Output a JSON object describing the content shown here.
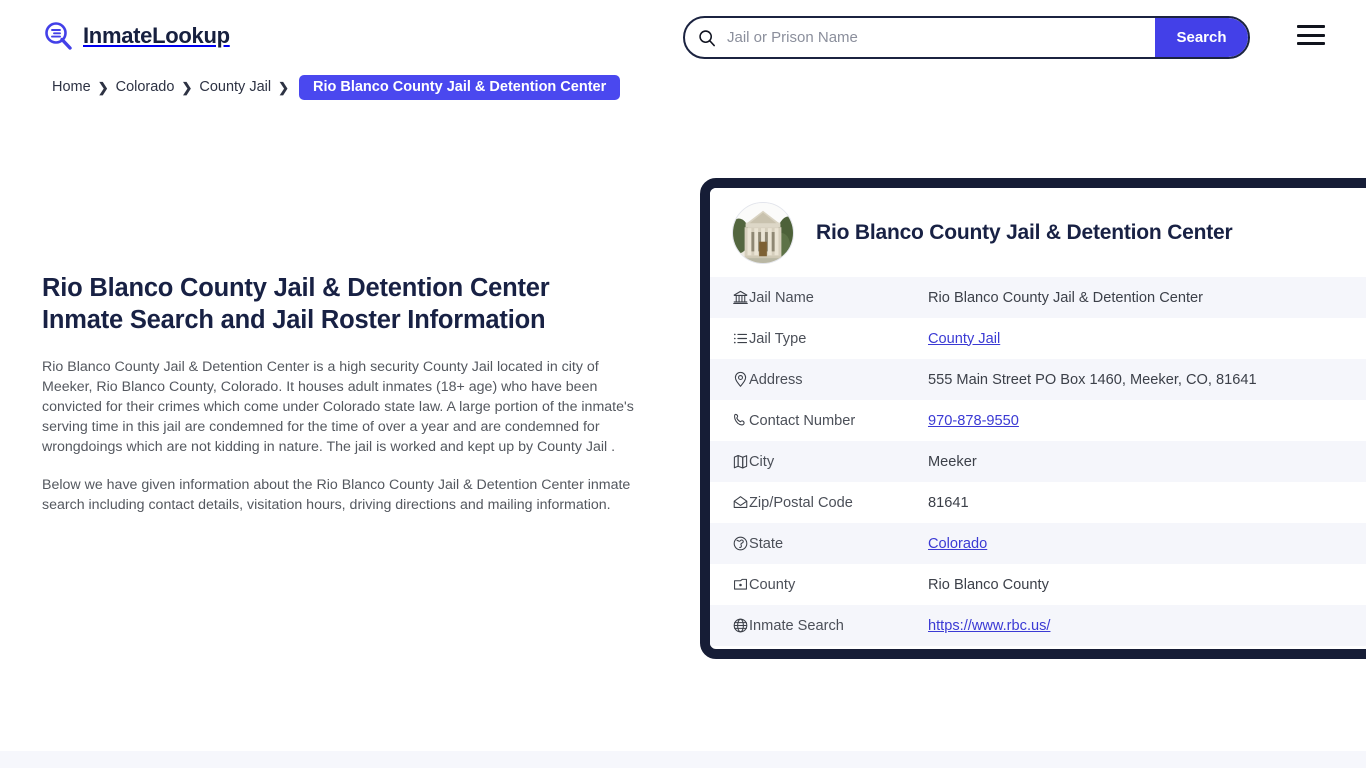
{
  "brand": {
    "name": "InmateLookup",
    "logo_icon": "search-list-icon",
    "accent_color": "#4340e8",
    "dark_color": "#161d36"
  },
  "search": {
    "placeholder": "Jail or Prison Name",
    "value": "",
    "button_label": "Search",
    "icon": "search-icon"
  },
  "menu": {
    "icon": "hamburger-menu-icon"
  },
  "breadcrumb": {
    "items": [
      {
        "label": "Home",
        "current": false
      },
      {
        "label": "Colorado",
        "current": false
      },
      {
        "label": "County Jail",
        "current": false
      },
      {
        "label": "Rio Blanco County Jail & Detention Center",
        "current": true
      }
    ],
    "separator": "❯"
  },
  "main": {
    "title": "Rio Blanco County Jail & Detention Center Inmate Search and Jail Roster Information",
    "paragraph_1": "Rio Blanco County Jail & Detention Center is a high security County Jail located in city of Meeker, Rio Blanco County, Colorado. It houses adult inmates (18+ age) who have been convicted for their crimes which come under Colorado state law. A large portion of the inmate's serving time in this jail are condemned for the time of over a year and are condemned for wrongdoings which are not kidding in nature. The jail is worked and kept up by County Jail .",
    "paragraph_2": "Below we have given information about the Rio Blanco County Jail & Detention Center inmate search including contact details, visitation hours, driving directions and mailing information."
  },
  "card": {
    "avatar_icon": "courthouse-building-photo",
    "title": "Rio Blanco County Jail & Detention Center",
    "rows": [
      {
        "icon": "bank-icon",
        "label": "Jail Name",
        "value": "Rio Blanco County Jail & Detention Center",
        "link": false
      },
      {
        "icon": "list-icon",
        "label": "Jail Type",
        "value": "County Jail",
        "link": true
      },
      {
        "icon": "map-pin-icon",
        "label": "Address",
        "value": "555 Main Street PO Box 1460, Meeker, CO, 81641",
        "link": false
      },
      {
        "icon": "phone-icon",
        "label": "Contact Number",
        "value": "970-878-9550",
        "link": true
      },
      {
        "icon": "map-icon",
        "label": "City",
        "value": "Meeker",
        "link": false
      },
      {
        "icon": "envelope-icon",
        "label": "Zip/Postal Code",
        "value": "81641",
        "link": false
      },
      {
        "icon": "globe-icon",
        "label": "State",
        "value": "Colorado",
        "link": true
      },
      {
        "icon": "map-location-icon",
        "label": "County",
        "value": "Rio Blanco County",
        "link": false
      },
      {
        "icon": "www-globe-icon",
        "label": "Inmate Search",
        "value": "https://www.rbc.us/",
        "link": true
      }
    ]
  }
}
